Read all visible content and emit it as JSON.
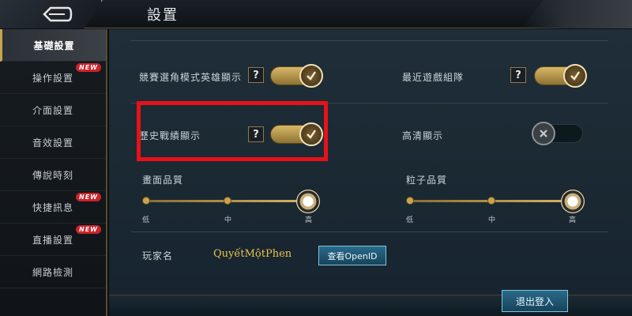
{
  "header": {
    "title": "設置",
    "back_icon": "back-arrow-icon"
  },
  "sidebar": {
    "items": [
      {
        "label": "基礎設置",
        "active": true,
        "new": false
      },
      {
        "label": "操作設置",
        "active": false,
        "new": true
      },
      {
        "label": "介面設置",
        "active": false,
        "new": false
      },
      {
        "label": "音效設置",
        "active": false,
        "new": false
      },
      {
        "label": "傳說時刻",
        "active": false,
        "new": false
      },
      {
        "label": "快捷訊息",
        "active": false,
        "new": true
      },
      {
        "label": "直播設置",
        "active": false,
        "new": true
      },
      {
        "label": "網路檢測",
        "active": false,
        "new": false
      }
    ],
    "new_badge": "NEW"
  },
  "settings": {
    "hero_display": {
      "label": "競賽選角模式英雄顯示",
      "help": "?",
      "on": true
    },
    "recent_team": {
      "label": "最近遊戲組隊",
      "help": "?",
      "on": true
    },
    "history_record": {
      "label": "歷史戰績顯示",
      "help": "?",
      "on": true
    },
    "hd_display": {
      "label": "高清顯示",
      "on": false
    }
  },
  "quality": {
    "graphics": {
      "label": "畫面品質",
      "ticks": [
        "低",
        "中",
        "高"
      ],
      "level": "高"
    },
    "particles": {
      "label": "粒子品質",
      "ticks": [
        "低",
        "中",
        "高"
      ],
      "level": "高"
    }
  },
  "player": {
    "label": "玩家名",
    "name": "QuyếtMộtPhen",
    "openid_button": "查看OpenID"
  },
  "footer": {
    "logout_button": "退出登入"
  },
  "colors": {
    "accent_gold": "#c9a54e",
    "highlight_red": "#e8111a",
    "button_blue": "#2a6a8a",
    "new_badge_red": "#c9242a"
  }
}
